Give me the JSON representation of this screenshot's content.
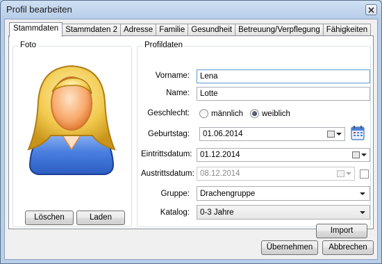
{
  "window": {
    "title": "Profil bearbeiten"
  },
  "tabs": [
    "Stammdaten",
    "Stammdaten 2",
    "Adresse",
    "Familie",
    "Gesundheit",
    "Betreuung/Verpflegung",
    "Fähigkeiten"
  ],
  "photo": {
    "group_title": "Foto",
    "delete_label": "Löschen",
    "load_label": "Laden"
  },
  "profile": {
    "group_title": "Profildaten",
    "firstname_label": "Vorname:",
    "firstname_value": "Lena",
    "lastname_label": "Name:",
    "lastname_value": "Lotte",
    "gender_label": "Geschlecht:",
    "gender_male": "männlich",
    "gender_female": "weiblich",
    "gender_selected": "weiblich",
    "birthday_label": "Geburtstag:",
    "birthday_value": "01.06.2014",
    "entry_label": "Eintrittsdatum:",
    "entry_value": "01.12.2014",
    "exit_label": "Austrittsdatum:",
    "exit_value": "08.12.2014",
    "group_label": "Gruppe:",
    "group_value": "Drachengruppe",
    "catalog_label": "Katalog:",
    "catalog_value": "0-3 Jahre",
    "import_label": "Import"
  },
  "footer": {
    "ok_label": "Übernehmen",
    "cancel_label": "Abbrechen"
  }
}
